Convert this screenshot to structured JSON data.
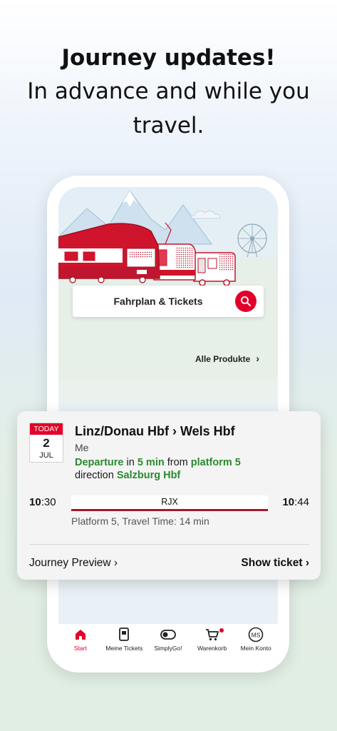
{
  "headline": {
    "line1": "Journey updates!",
    "line2": "In advance and while you",
    "line3": "travel."
  },
  "app": {
    "search_label": "Fahrplan & Tickets",
    "all_products": "Alle Produkte",
    "tabs": [
      {
        "label": "Start",
        "icon": "home-icon",
        "active": true
      },
      {
        "label": "Meine Tickets",
        "icon": "ticket-icon",
        "active": false
      },
      {
        "label": "SimplyGo!",
        "icon": "toggle-icon",
        "active": false
      },
      {
        "label": "Warenkorb",
        "icon": "cart-icon",
        "active": false,
        "badge": true
      },
      {
        "label": "Mein Konto",
        "icon": "account-icon",
        "active": false,
        "initials": "MS"
      }
    ]
  },
  "journey": {
    "badge_top": "TODAY",
    "badge_day": "2",
    "badge_month": "JUL",
    "route": "Linz/Donau Hbf › Wels Hbf",
    "passenger": "Me",
    "departure_word": "Departure",
    "in_word": " in ",
    "minutes": "5 min",
    "from_word": " from ",
    "platform_text": "platform 5",
    "direction_word": "direction ",
    "direction": "Salzburg Hbf",
    "dep_time_hour": "10",
    "dep_time_min": ":30",
    "arr_time_hour": "10",
    "arr_time_min": ":44",
    "train": "RJX",
    "platform_info": "Platform 5, Travel Time: 14 min",
    "preview_link": "Journey Preview ›",
    "show_ticket": "Show ticket ›"
  },
  "colors": {
    "accent": "#e2002a",
    "green": "#2a8a2e",
    "train_bar": "#a6172d"
  }
}
